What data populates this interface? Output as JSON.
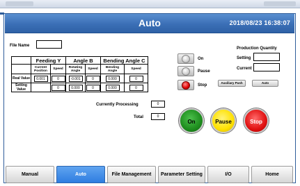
{
  "header": {
    "title": "Auto",
    "datetime": "2018/08/23   16:38:07"
  },
  "file": {
    "label": "File Name",
    "value": ""
  },
  "table": {
    "groups": [
      "Feeding Y",
      "Angle B",
      "Bending Angle C"
    ],
    "subheaders": [
      "Current Position",
      "Speed",
      "Rotating Angle",
      "Speed",
      "Bending Angle",
      "Speed"
    ],
    "rows": [
      {
        "label": "Real Value",
        "values": [
          "0.001",
          "0",
          "-0.001",
          "0",
          "0.000",
          "0"
        ]
      },
      {
        "label": "Setting Value",
        "values": [
          "",
          "0",
          "0.000",
          "0",
          "0.000",
          "0"
        ]
      }
    ]
  },
  "processing": {
    "label": "Currently Processing",
    "value": "0",
    "total_label": "Total",
    "total_value": "0"
  },
  "indicators": {
    "on": "On",
    "pause": "Pause",
    "stop": "Stop"
  },
  "production": {
    "title": "Production Quantity",
    "setting_label": "Setting",
    "setting_value": "",
    "current_label": "Current",
    "current_value": ""
  },
  "small_buttons": {
    "auxiliary": "Auxiliary Push",
    "auto": "Auto"
  },
  "controls": {
    "on": "On",
    "pause": "Pause",
    "stop": "Stop"
  },
  "nav": [
    {
      "label": "Manual",
      "active": false
    },
    {
      "label": "Auto",
      "active": true
    },
    {
      "label": "File Management",
      "active": false
    },
    {
      "label": "Parameter Setting",
      "active": false
    },
    {
      "label": "I/O",
      "active": false
    },
    {
      "label": "Home",
      "active": false
    }
  ]
}
